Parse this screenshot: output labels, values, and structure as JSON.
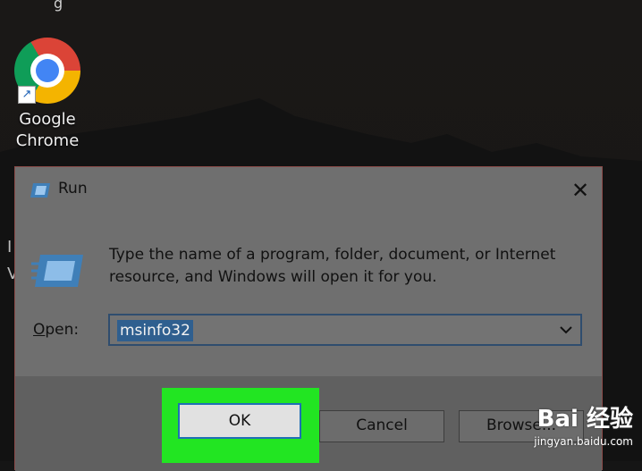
{
  "desktop": {
    "top_sliver_text": "g",
    "icons": [
      {
        "label_line1": "Google",
        "label_line2": "Chrome",
        "icon": "chrome-icon"
      }
    ],
    "left_edge_glyphs": [
      "I",
      "V"
    ]
  },
  "run_dialog": {
    "title": "Run",
    "close_glyph": "✕",
    "description": "Type the name of a program, folder, document, or Internet resource, and Windows will open it for you.",
    "open_label_access_key": "O",
    "open_label_rest": "pen:",
    "open_value": "msinfo32",
    "ok_label": "OK",
    "cancel_label": "Cancel",
    "browse_label": "Browse..."
  },
  "highlight_color": "#22e522",
  "watermark": {
    "logo": "Bai 经验",
    "url": "jingyan.baidu.com"
  }
}
